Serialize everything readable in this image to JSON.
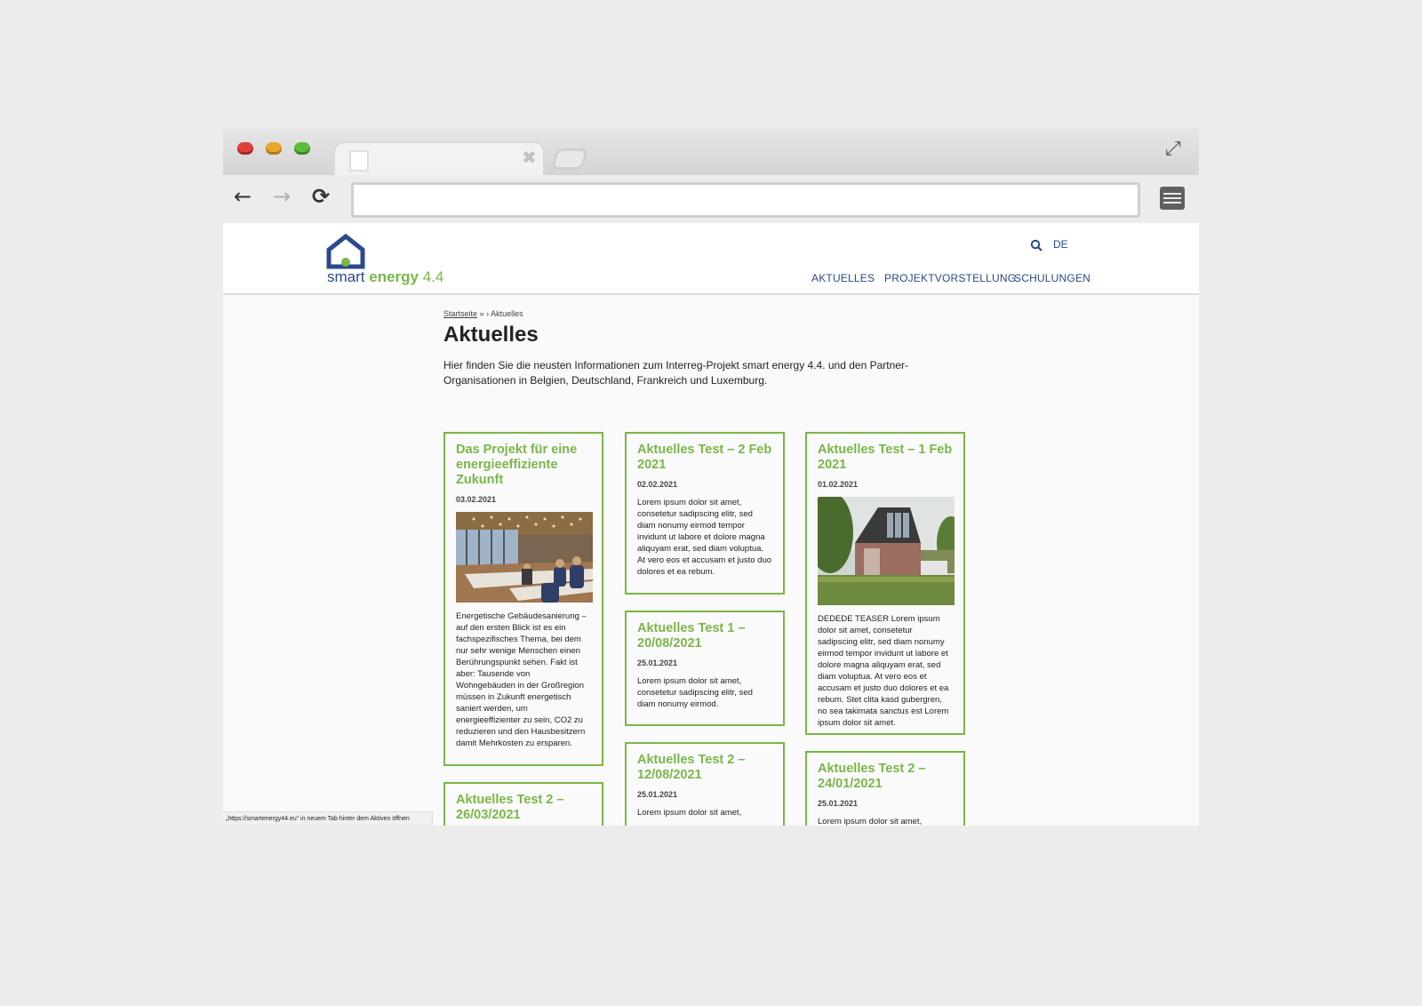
{
  "browser": {
    "controls": {
      "close_color": "#e0413b",
      "minimize_color": "#e6a72b",
      "zoom_color": "#5cbd3c"
    },
    "tab": {
      "close_icon": "close-icon"
    },
    "nav": {
      "back": "←",
      "forward": "→",
      "reload": "⟳"
    },
    "address": {
      "value": ""
    },
    "status_text": "„https://smartenergy44.eu“ in neuem Tab hinter dem Aktiven öffnen"
  },
  "site": {
    "colors": {
      "primary_blue": "#2a4a8a",
      "accent_green": "#7ab648"
    },
    "logo": {
      "word1": "smart",
      "word2": "energy",
      "word3": "4.4"
    },
    "language": "DE",
    "nav": [
      {
        "label": "AKTUELLES"
      },
      {
        "label": "PROJEKTVORSTELLUNG"
      },
      {
        "label": "SCHULUNGEN"
      }
    ]
  },
  "page": {
    "breadcrumb": {
      "home": "Startseite",
      "sep1": "»",
      "sep2": "›",
      "current": "Aktuelles"
    },
    "title": "Aktuelles",
    "intro": "Hier finden Sie die neusten Informationen zum Interreg-Projekt smart energy 4.4. und den Partner-Organisationen in Belgien, Deutschland, Frankreich und Luxemburg."
  },
  "cards": [
    {
      "title": "Das Projekt für eine energieeffiziente Zukunft",
      "date": "03.02.2021",
      "image": "conference-room-photo",
      "text": "Energetische Gebäudesanierung – auf den ersten Blick ist es ein fachspezifisches Thema, bei dem nur sehr wenige Menschen einen Berührungspunkt sehen. Fakt ist aber: Tausende von Wohngebäuden in der Großregion müssen in Zukunft energetisch saniert werden, um energieeffizienter zu sein, CO2 zu reduzieren und den Hausbesitzern damit Mehrkosten zu ersparen."
    },
    {
      "title": "Aktuelles Test – 2 Feb 2021",
      "date": "02.02.2021",
      "text": "Lorem ipsum dolor sit amet, consetetur sadipscing elitr, sed diam nonumy eirmod tempor invidunt ut labore et dolore magna aliquyam erat, sed diam voluptua. At vero eos et accusam et justo duo dolores et ea rebum."
    },
    {
      "title": "Aktuelles Test – 1 Feb 2021",
      "date": "01.02.2021",
      "image": "house-photo",
      "text": "DEDEDE TEASER Lorem ipsum dolor sit amet, consetetur sadipscing elitr, sed diam nonumy eirmod tempor invidunt ut labore et dolore magna aliquyam erat, sed diam voluptua. At vero eos et accusam et justo duo dolores et ea rebum. Stet clita kasd gubergren, no sea takimata sanctus est Lorem ipsum dolor sit amet."
    },
    {
      "title": "Aktuelles Test 1 – 20/08/2021",
      "date": "25.01.2021",
      "text": "Lorem ipsum dolor sit amet, consetetur sadipscing elitr, sed diam nonumy eirmod."
    },
    {
      "title": "Aktuelles Test 2 – 26/03/2021",
      "date": "",
      "text": ""
    },
    {
      "title": "Aktuelles Test 2 – 12/08/2021",
      "date": "25.01.2021",
      "text": "Lorem ipsum dolor sit amet,"
    },
    {
      "title": "Aktuelles Test 2 – 24/01/2021",
      "date": "25.01.2021",
      "text": "Lorem ipsum dolor sit amet,"
    }
  ]
}
